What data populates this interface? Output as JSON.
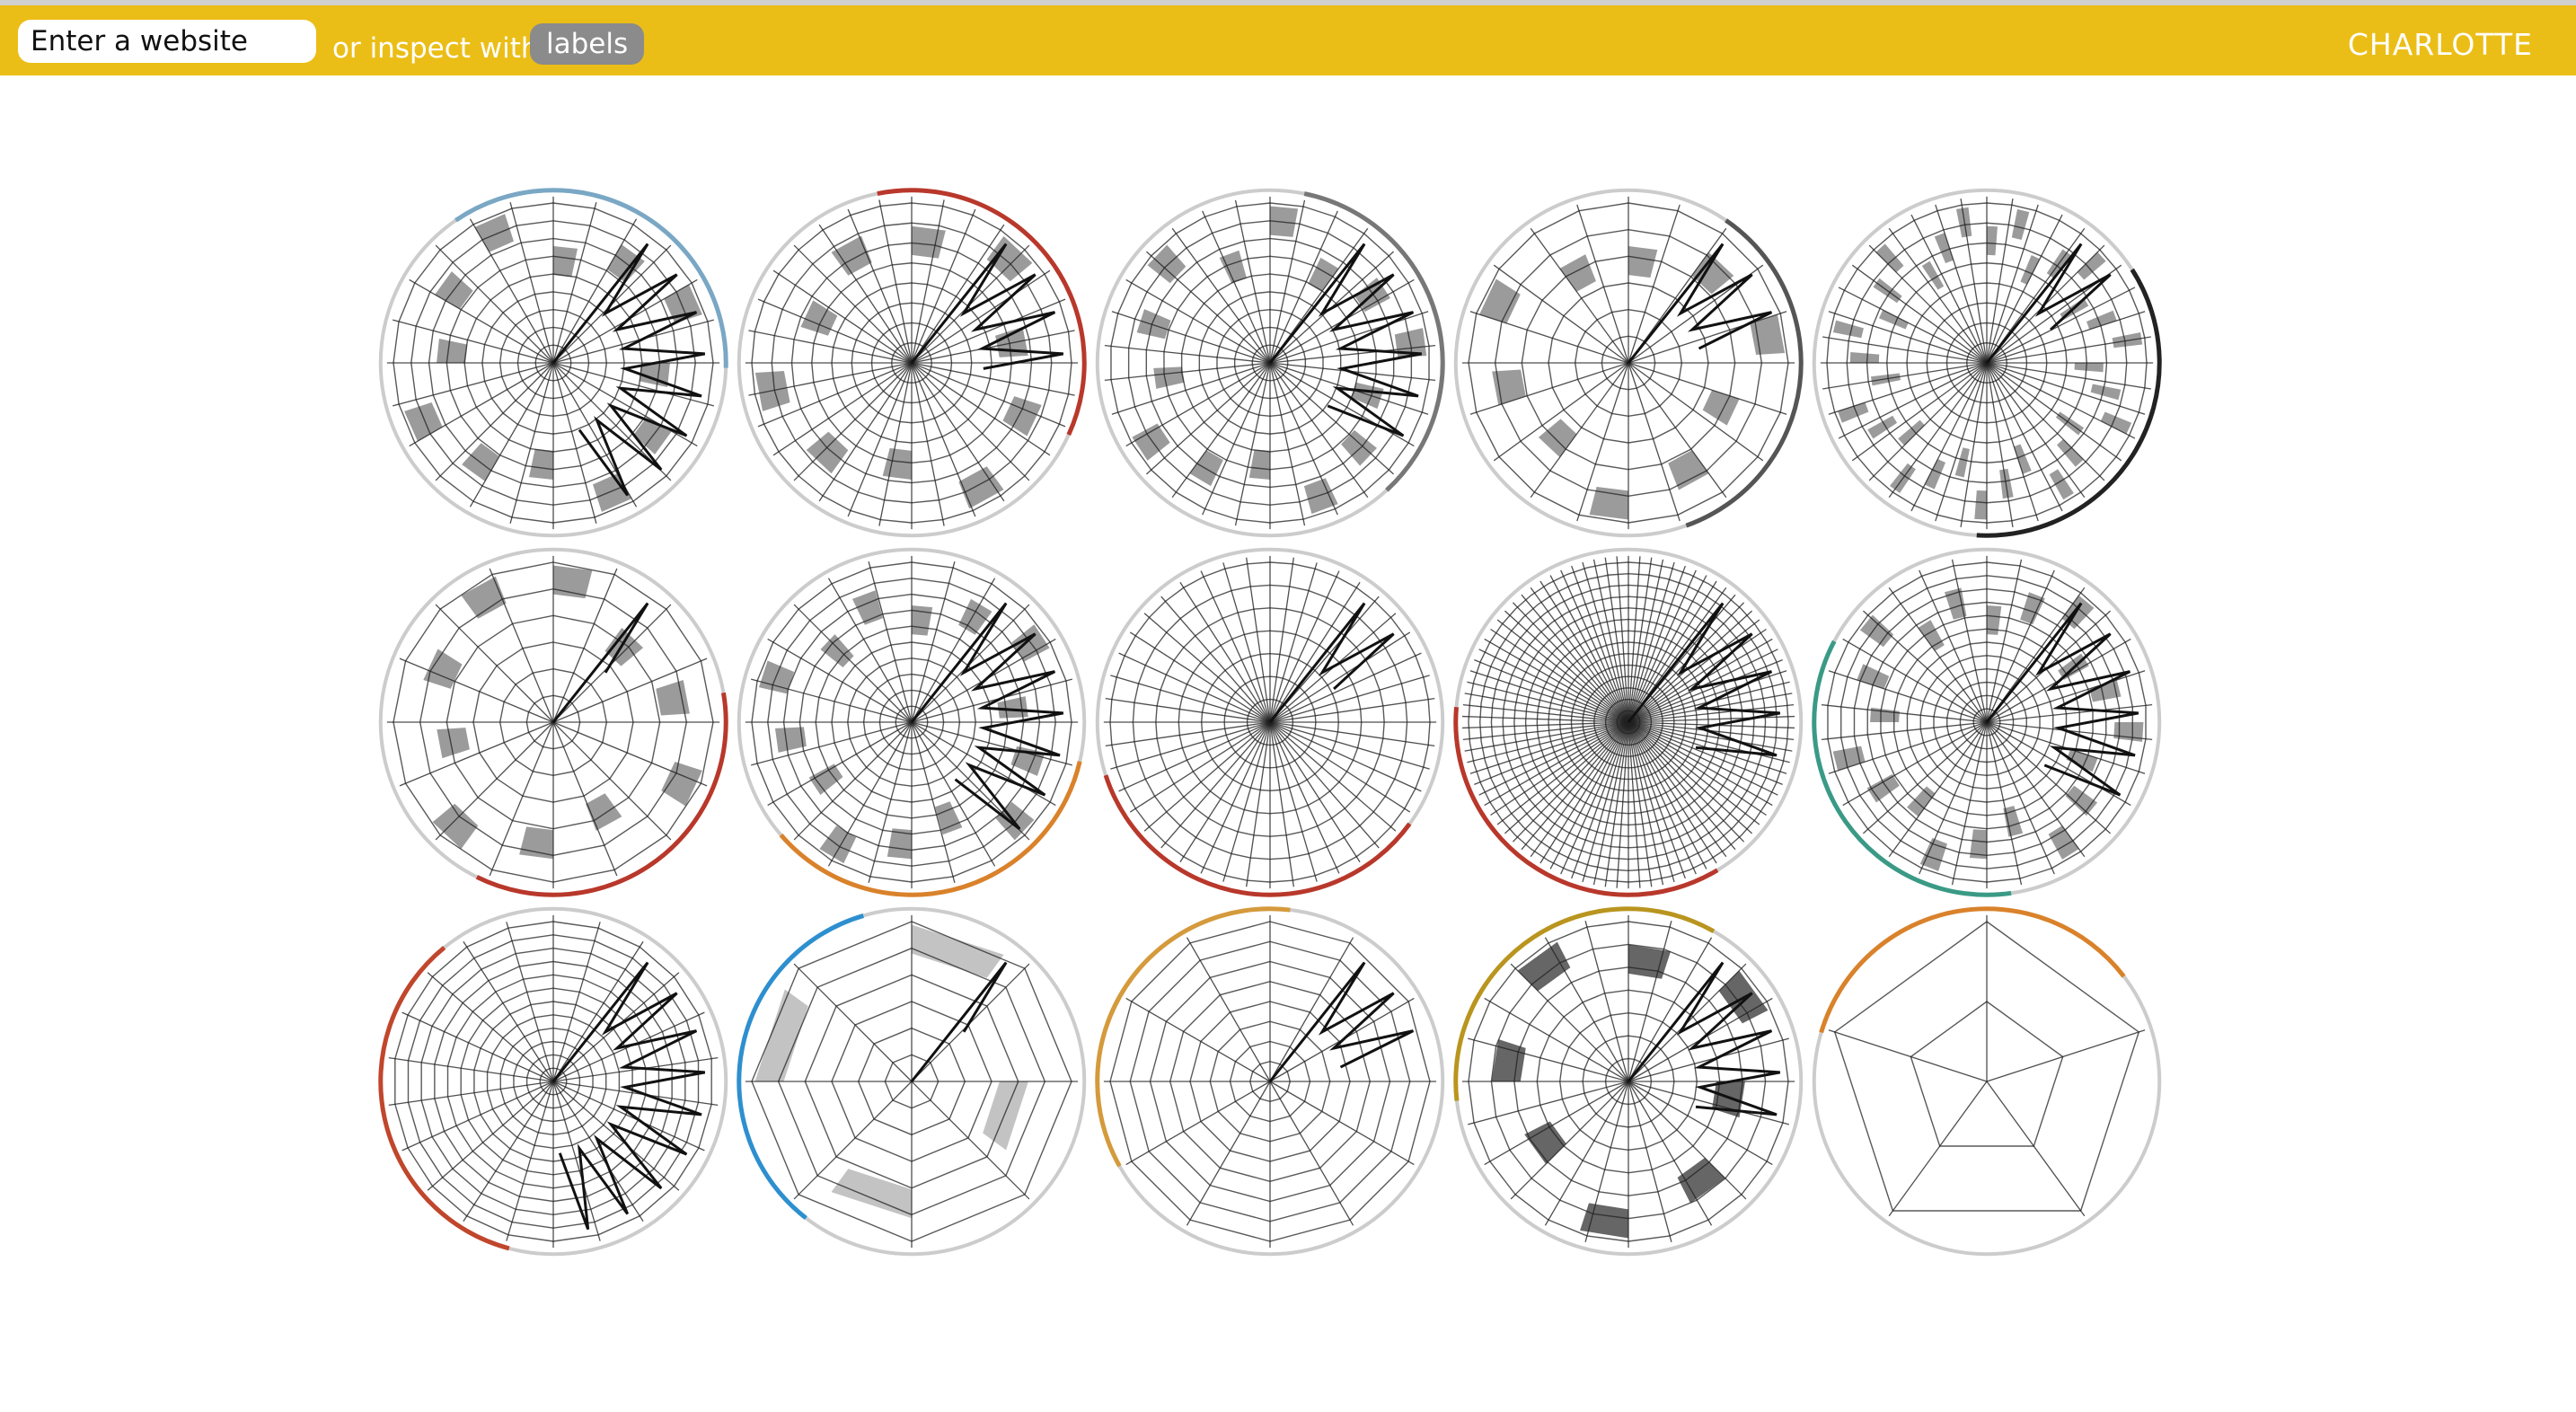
{
  "header": {
    "search_placeholder": "Enter a website",
    "inspect_text": "or inspect with",
    "labels_button": "labels",
    "brand": "CHARLOTTE"
  },
  "colors": {
    "header_bg": "#ebbe17",
    "ink": "#222222",
    "fill_grey": "#7a7a7a",
    "accent_red": "#b8382b",
    "accent_orange": "#d9822b",
    "accent_blue": "#2e8fcf",
    "accent_gold": "#b9951f",
    "accent_teal": "#3a9a86"
  },
  "gallery": [
    {
      "spokes": 24,
      "rings": 9,
      "zig": 8,
      "blocks": 12,
      "arc": "#7aa7c4"
    },
    {
      "spokes": 32,
      "rings": 8,
      "zig": 4,
      "blocks": 10,
      "arc": "#b8382b"
    },
    {
      "spokes": 30,
      "rings": 9,
      "zig": 6,
      "blocks": 14,
      "arc": "#777777"
    },
    {
      "spokes": 20,
      "rings": 6,
      "zig": 3,
      "blocks": 10,
      "arc": "#555555"
    },
    {
      "spokes": 40,
      "rings": 8,
      "zig": 2,
      "blocks": 32,
      "arc": "#222222"
    },
    {
      "spokes": 16,
      "rings": 6,
      "zig": 1,
      "blocks": 10,
      "arc": "#b8382b"
    },
    {
      "spokes": 24,
      "rings": 10,
      "zig": 7,
      "blocks": 14,
      "arc": "#d9822b"
    },
    {
      "spokes": 44,
      "rings": 7,
      "zig": 2,
      "blocks": 0,
      "arc": "#b8382b"
    },
    {
      "spokes": 90,
      "rings": 14,
      "zig": 5,
      "blocks": 0,
      "arc": "#b8382b"
    },
    {
      "spokes": 30,
      "rings": 12,
      "zig": 6,
      "blocks": 20,
      "arc": "#3a9a86"
    },
    {
      "spokes": 22,
      "rings": 12,
      "zig": 9,
      "blocks": 0,
      "arc": "#c0462c"
    },
    {
      "spokes": 8,
      "rings": 6,
      "zig": 1,
      "blocks": 4,
      "arc": "#2e8fcf"
    },
    {
      "spokes": 12,
      "rings": 8,
      "zig": 3,
      "blocks": 0,
      "arc": "#d49a3c"
    },
    {
      "spokes": 24,
      "rings": 7,
      "zig": 5,
      "blocks": 8,
      "arc": "#b9951f"
    },
    {
      "spokes": 5,
      "rings": 2,
      "zig": 0,
      "blocks": 0,
      "arc": "#d9822b"
    }
  ]
}
